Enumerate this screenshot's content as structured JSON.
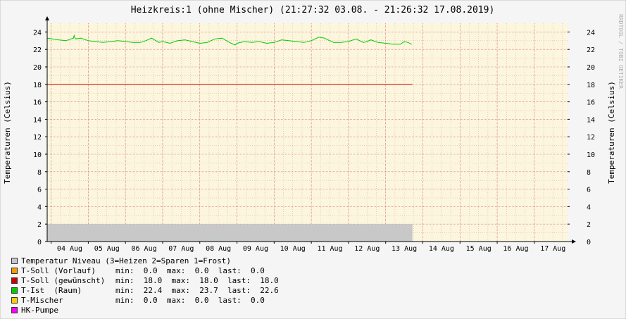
{
  "title": "Heizkreis:1 (ohne Mischer) (21:27:32 03.08. - 21:26:32 17.08.2019)",
  "watermark": "RRDTOOL / TOBI OETIKER",
  "chart_data": {
    "type": "line",
    "ylabel_left": "Temperaturen (Celsius)",
    "ylabel_right": "Temperaturen (Celsius)",
    "ylim": [
      0,
      25
    ],
    "yticks": [
      "0",
      "2",
      "4",
      "6",
      "8",
      "10",
      "12",
      "14",
      "16",
      "18",
      "20",
      "22",
      "24"
    ],
    "xticks": [
      "04 Aug",
      "05 Aug",
      "06 Aug",
      "07 Aug",
      "08 Aug",
      "09 Aug",
      "10 Aug",
      "11 Aug",
      "12 Aug",
      "13 Aug",
      "14 Aug",
      "15 Aug",
      "16 Aug",
      "17 Aug"
    ],
    "xlim_days": [
      3.894,
      17.893
    ],
    "data_end_day": 13.72,
    "grid": true,
    "colors": {
      "plot_bg": "#fbf6dd",
      "grid": "#e6a0a0",
      "niveau": "#c8c8c8",
      "soll": "#cc0000",
      "ist": "#00cc00"
    },
    "series": [
      {
        "name": "Temperatur Niveau",
        "type": "area",
        "x_days": [
          3.894,
          13.72
        ],
        "values": [
          2,
          2
        ]
      },
      {
        "name": "T-Soll (gewünscht)",
        "x_days": [
          3.894,
          13.72
        ],
        "values": [
          18,
          18
        ]
      },
      {
        "name": "T-Ist (Raum)",
        "x_days": [
          3.9,
          4.2,
          4.4,
          4.6,
          4.62,
          4.65,
          4.8,
          5.0,
          5.2,
          5.4,
          5.6,
          5.8,
          6.0,
          6.2,
          6.4,
          6.55,
          6.7,
          6.9,
          7.0,
          7.2,
          7.4,
          7.6,
          7.8,
          8.0,
          8.2,
          8.4,
          8.6,
          8.8,
          8.95,
          9.0,
          9.2,
          9.4,
          9.6,
          9.8,
          10.0,
          10.2,
          10.4,
          10.6,
          10.8,
          11.0,
          11.2,
          11.35,
          11.5,
          11.6,
          11.8,
          12.0,
          12.2,
          12.4,
          12.5,
          12.6,
          12.8,
          13.0,
          13.2,
          13.4,
          13.5,
          13.6,
          13.7
        ],
        "values": [
          23.3,
          23.1,
          23.0,
          23.3,
          23.6,
          23.2,
          23.3,
          23.0,
          22.9,
          22.8,
          22.9,
          23.0,
          22.9,
          22.8,
          22.8,
          23.0,
          23.3,
          22.8,
          22.9,
          22.7,
          23.0,
          23.1,
          22.9,
          22.7,
          22.8,
          23.2,
          23.3,
          22.8,
          22.5,
          22.7,
          22.9,
          22.8,
          22.9,
          22.7,
          22.8,
          23.1,
          23.0,
          22.9,
          22.8,
          23.0,
          23.4,
          23.3,
          23.0,
          22.8,
          22.8,
          22.9,
          23.2,
          22.8,
          22.9,
          23.1,
          22.8,
          22.7,
          22.6,
          22.6,
          22.9,
          22.8,
          22.6
        ]
      }
    ]
  },
  "legend": [
    {
      "color": "#c8c8c8",
      "label": "Temperatur Niveau (3=Heizen 2=Sparen 1=Frost)",
      "stats": ""
    },
    {
      "color": "#ff9900",
      "label": "T-Soll (Vorlauf)",
      "stats": "min:  0.0  max:  0.0  last:  0.0"
    },
    {
      "color": "#cc0000",
      "label": "T-Soll (gewünscht)",
      "stats": "min:  18.0  max:  18.0  last:  18.0"
    },
    {
      "color": "#00cc00",
      "label": "T-Ist  (Raum)",
      "stats": "min:  22.4  max:  23.7  last:  22.6"
    },
    {
      "color": "#ffcc00",
      "label": "T-Mischer",
      "stats": "min:  0.0  max:  0.0  last:  0.0"
    },
    {
      "color": "#ff00ff",
      "label": "HK-Pumpe",
      "stats": ""
    }
  ]
}
